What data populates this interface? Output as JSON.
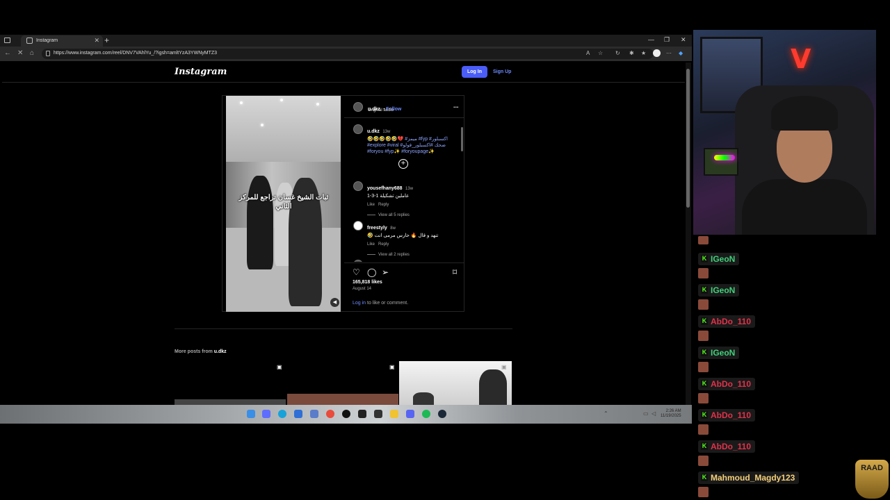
{
  "browser": {
    "tab_title": "Instagram",
    "url": "https://www.instagram.com/reel/DNV7VAhlYu_/?igsh=amltYzA3YWNyMTZ3"
  },
  "instagram": {
    "logo": "Instagram",
    "login_label": "Log In",
    "signup_label": "Sign Up",
    "post": {
      "author": "u.dkz",
      "follow_label": "Follow",
      "audio": "Original audio",
      "more_icon": "...",
      "video_caption": "ثبات الشيخ غسان تراجع للمركز الثاني",
      "caption_user": "u.dkz",
      "caption_time": "13w",
      "caption_text": "🤣🤣🤣🤣🤣💔 #ميمز #fyp #اكسبلور",
      "caption_tags_1": "#explore #viral #ضحك #اكسبلور_فولو",
      "caption_tags_2": "#foryou #fyp✨ #foryoupage✨",
      "comments": [
        {
          "user": "yousefhany688",
          "time": "13w",
          "text": "عاملين تشكيلة 1-3-1",
          "like": "Like",
          "reply": "Reply",
          "replies": "View all 5 replies"
        },
        {
          "user": "freestyly",
          "time": "8w",
          "text": "🤣 تنهد و قال 🔥 حارس مرمى انت",
          "like": "Like",
          "reply": "Reply",
          "replies": "View all 2 replies"
        },
        {
          "user": "bk_adem_13",
          "time": "7w"
        }
      ],
      "likes": "165,818 likes",
      "date": "August 14",
      "login_prompt_link": "Log in",
      "login_prompt_rest": " to like or comment."
    },
    "more_posts_prefix": "More posts from ",
    "more_posts_user": "u.dkz"
  },
  "taskbar": {
    "time": "2:26 AM",
    "date": "11/19/2025"
  },
  "chat": [
    {
      "name": "IGeoN",
      "color": "#3fd17a"
    },
    {
      "name": "IGeoN",
      "color": "#3fd17a"
    },
    {
      "name": "AbDo_110",
      "color": "#e0324a"
    },
    {
      "name": "IGeoN",
      "color": "#3fd17a"
    },
    {
      "name": "AbDo_110",
      "color": "#e0324a"
    },
    {
      "name": "AbDo_110",
      "color": "#e0324a"
    },
    {
      "name": "AbDo_110",
      "color": "#e0324a"
    },
    {
      "name": "Mahmoud_Magdy123",
      "color": "#f5d07a"
    }
  ],
  "badge": "RAAD"
}
